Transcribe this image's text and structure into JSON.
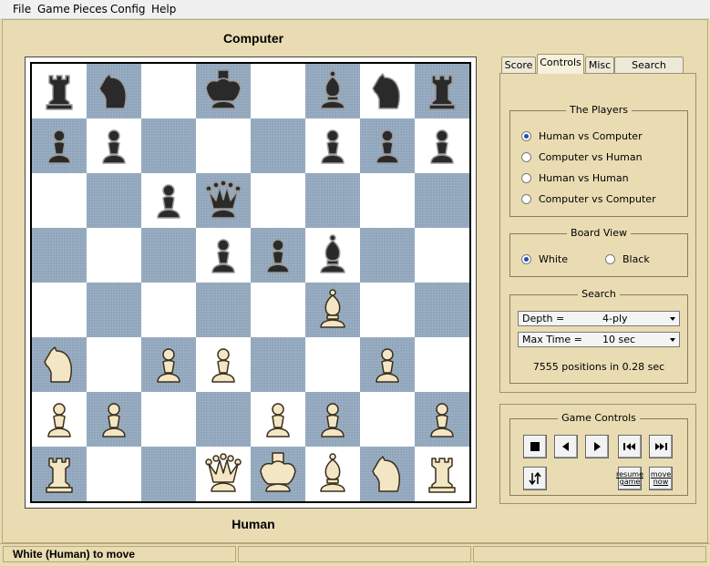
{
  "menu": [
    "File",
    "Game",
    "Pieces",
    "Config",
    "Help"
  ],
  "players": {
    "top": "Computer",
    "bottom": "Human"
  },
  "board": {
    "rows": [
      [
        "r",
        "n",
        "",
        "k",
        "",
        "b",
        "n",
        "r"
      ],
      [
        "p",
        "p",
        "",
        "",
        "",
        "p",
        "p",
        "p"
      ],
      [
        "",
        "",
        "p",
        "q",
        "",
        "",
        "",
        ""
      ],
      [
        "",
        "",
        "",
        "p",
        "p",
        "b",
        "",
        ""
      ],
      [
        "",
        "",
        "",
        "",
        "",
        "B",
        "",
        ""
      ],
      [
        "N",
        "",
        "P",
        "P",
        "",
        "",
        "P",
        ""
      ],
      [
        "P",
        "P",
        "",
        "",
        "P",
        "P",
        "",
        "P"
      ],
      [
        "R",
        "",
        "",
        "Q",
        "K",
        "B",
        "N",
        "R"
      ]
    ]
  },
  "tabs": [
    "Score",
    "Controls",
    "Misc",
    "Search Status"
  ],
  "active_tab": "Controls",
  "the_players": {
    "title": "The Players",
    "options": [
      "Human vs Computer",
      "Computer vs Human",
      "Human vs Human",
      "Computer vs Computer"
    ],
    "selected": 0
  },
  "board_view": {
    "title": "Board View",
    "options": [
      "White",
      "Black"
    ],
    "selected": 0
  },
  "search": {
    "title": "Search",
    "depth_label": "Depth  =",
    "depth_value": "4-ply",
    "maxtime_label": "Max Time  =",
    "maxtime_value": "10 sec",
    "stats": "7555 positions in 0.28 sec"
  },
  "game_controls": {
    "title": "Game Controls",
    "resume_line1": "resume",
    "resume_line2": "game",
    "move_line1": "move",
    "move_line2": "now"
  },
  "status": {
    "left": "White (Human) to move",
    "middle": "",
    "right": ""
  },
  "colors": {
    "dark_square": "#8fa5bb",
    "light_square": "#ffffff",
    "background": "#e9dcb3",
    "accent": "#1c4fb0"
  }
}
